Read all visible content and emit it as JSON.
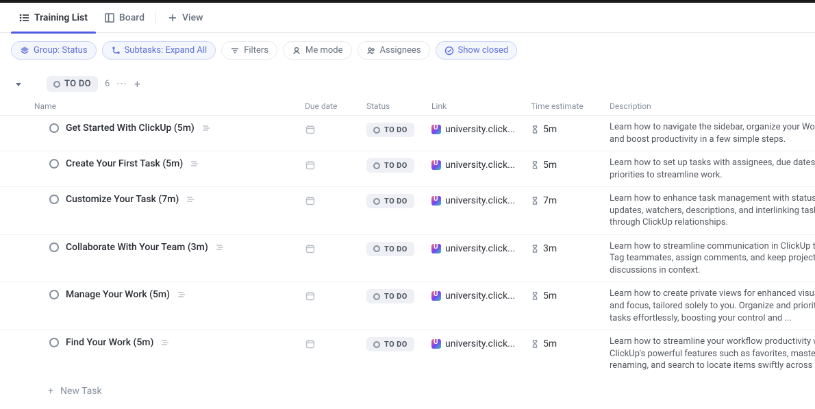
{
  "tabs": {
    "training_list": "Training List",
    "board": "Board",
    "view": "View"
  },
  "filters": {
    "group": "Group: Status",
    "subtasks": "Subtasks: Expand All",
    "filters": "Filters",
    "me_mode": "Me mode",
    "assignees": "Assignees",
    "show_closed": "Show closed"
  },
  "group": {
    "label": "TO DO",
    "count": "6"
  },
  "columns": {
    "name": "Name",
    "due_date": "Due date",
    "status": "Status",
    "link": "Link",
    "time_estimate": "Time estimate",
    "description": "Description"
  },
  "status_label": "TO DO",
  "link_text": "university.click...",
  "tasks": [
    {
      "name": "Get Started With ClickUp (5m)",
      "time": "5m",
      "desc": "Learn how to navigate the sidebar, organize your Workspace, and boost productivity in a few simple steps."
    },
    {
      "name": "Create Your First Task (5m)",
      "time": "5m",
      "desc": "Learn how to set up tasks with assignees, due dates, and priorities to streamline work."
    },
    {
      "name": "Customize Your Task (7m)",
      "time": "7m",
      "desc": "Learn how to enhance task management with status updates, watchers, descriptions, and interlinking tasks through ClickUp relationships."
    },
    {
      "name": "Collaborate With Your Team (3m)",
      "time": "3m",
      "desc": "Learn how to streamline communication in ClickUp tasks. Tag teammates, assign comments, and keep project discussions in context."
    },
    {
      "name": "Manage Your Work (5m)",
      "time": "5m",
      "desc": "Learn how to create private views for enhanced visualization and focus, tailored solely to you. Organize and prioritize tasks effortlessly, boosting your control and ..."
    },
    {
      "name": "Find Your Work (5m)",
      "time": "5m",
      "desc": "Learn how to streamline your workflow productivity with ClickUp's powerful features such as favorites, master renaming, and search to locate items swiftly across spaces."
    }
  ],
  "new_task": "New Task"
}
